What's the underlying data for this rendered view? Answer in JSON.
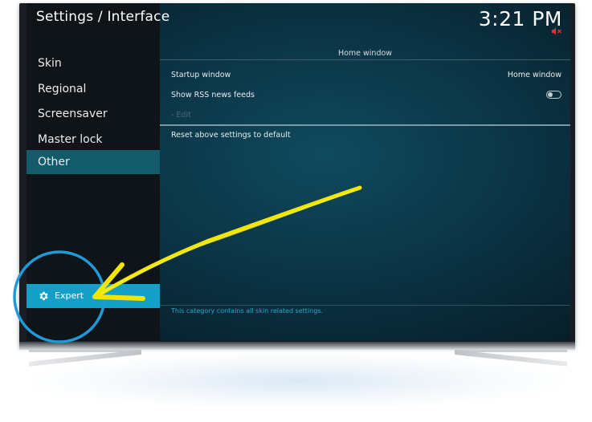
{
  "header": {
    "title": "Settings / Interface",
    "clock": "3:21 PM"
  },
  "sidebar": {
    "items": [
      {
        "label": "Skin",
        "active": false
      },
      {
        "label": "Regional",
        "active": false
      },
      {
        "label": "Screensaver",
        "active": false
      },
      {
        "label": "Master lock",
        "active": false
      },
      {
        "label": "Other",
        "active": true
      }
    ],
    "settings_level": {
      "label": "Expert",
      "icon": "gear-icon"
    }
  },
  "content": {
    "group_title": "Home window",
    "rows": [
      {
        "label": "Startup window",
        "value": "Home window"
      },
      {
        "label": "Show RSS news feeds",
        "control": "toggle",
        "state": "off"
      },
      {
        "label": "- Edit",
        "disabled": true
      }
    ],
    "reset_label": "Reset above settings to default",
    "help_text": "This category contains all skin related settings."
  },
  "colors": {
    "accent": "#12a0c8",
    "active_item": "#135b6b",
    "annotation_arrow": "#f2e600",
    "annotation_circle": "#1f9ad6"
  }
}
